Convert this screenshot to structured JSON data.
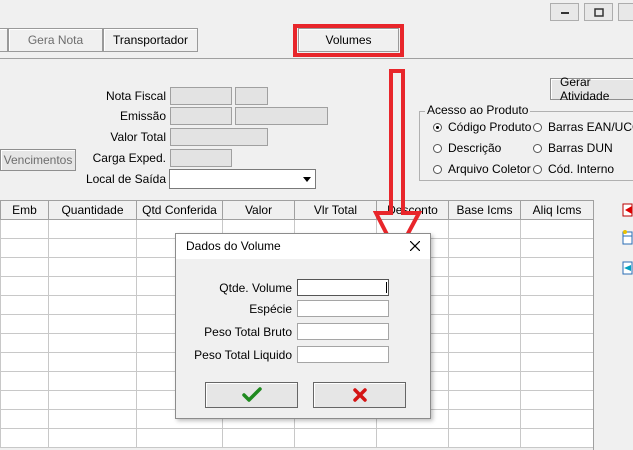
{
  "window": {
    "controls": [
      "minimize-icon",
      "restore-icon",
      "close-icon"
    ]
  },
  "toolbar": {
    "gera_nota": "Gera Nota",
    "transportador": "Transportador",
    "volumes": "Volumes",
    "gerar_atividade": "Gerar Atividade"
  },
  "form": {
    "nota_fiscal": "Nota Fiscal",
    "emissao": "Emissão",
    "valor_total": "Valor Total",
    "carga_exped": "Carga Exped.",
    "local_saida": "Local de Saída",
    "vencimentos": "Vencimentos"
  },
  "acesso": {
    "title": "Acesso ao Produto",
    "options": [
      {
        "label": "Código Produto",
        "selected": true
      },
      {
        "label": "Barras EAN/UCC",
        "selected": false
      },
      {
        "label": "Descrição",
        "selected": false
      },
      {
        "label": "Barras DUN",
        "selected": false
      },
      {
        "label": "Arquivo Coletor",
        "selected": false
      },
      {
        "label": "Cód. Interno",
        "selected": false
      }
    ]
  },
  "grid": {
    "columns": [
      "Emb",
      "Quantidade",
      "Qtd Conferida",
      "Valor",
      "Vlr Total",
      "Desconto",
      "Base Icms",
      "Aliq Icms"
    ]
  },
  "dialog": {
    "title": "Dados do Volume",
    "fields": {
      "qtde_volume": "Qtde. Volume",
      "especie": "Espécie",
      "peso_bruto": "Peso Total Bruto",
      "peso_liquido": "Peso Total Liquido"
    },
    "ok_icon": "check-icon",
    "cancel_icon": "x-icon"
  },
  "colors": {
    "highlight": "#e8262b",
    "ok": "#1f8a1f",
    "cancel": "#d41414"
  }
}
